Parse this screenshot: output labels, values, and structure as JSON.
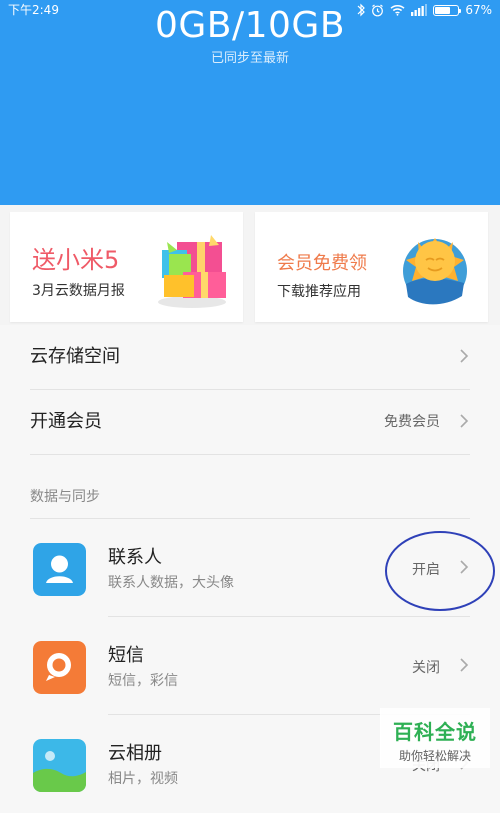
{
  "status_bar": {
    "time": "下午2:49",
    "battery_text": "67%",
    "battery_level": 0.67,
    "icons": [
      "bluetooth-icon",
      "alarm-icon",
      "wifi-icon",
      "signal-icon",
      "battery-icon"
    ]
  },
  "header": {
    "storage": "0GB/10GB",
    "sync_status": "已同步至最新",
    "background": "#2f9bf2"
  },
  "promo_cards": [
    {
      "title": "送小米5",
      "subtitle": "3月云数据月报",
      "icon": "gift-icon"
    },
    {
      "title": "会员免费领",
      "subtitle": "下载推荐应用",
      "icon": "sun-icon"
    }
  ],
  "menu": {
    "storage_label": "云存储空间",
    "membership_label": "开通会员",
    "membership_value": "免费会员"
  },
  "section": {
    "title": "数据与同步"
  },
  "items": [
    {
      "title": "联系人",
      "subtitle": "联系人数据，大头像",
      "status": "开启",
      "icon": "contacts-icon",
      "icon_color": "#2fa4e7"
    },
    {
      "title": "短信",
      "subtitle": "短信，彩信",
      "status": "关闭",
      "icon": "sms-icon",
      "icon_color": "#f47b37"
    },
    {
      "title": "云相册",
      "subtitle": "相片，视频",
      "status": "关闭",
      "icon": "gallery-icon",
      "icon_color": "#3cb8e8"
    }
  ],
  "watermark": {
    "title": "百科全说",
    "subtitle": "助你轻松解决"
  }
}
